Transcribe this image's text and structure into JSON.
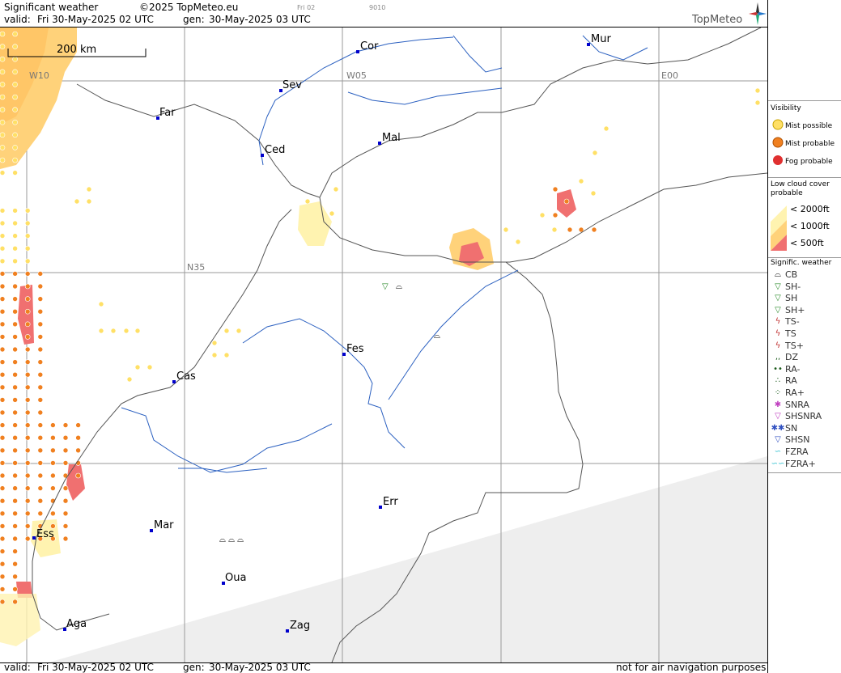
{
  "header": {
    "title": "Significant weather",
    "copyright": "©2025 TopMeteo.eu",
    "tiny_day": "Fri 02",
    "tiny_code": "9010",
    "valid_label": "valid:",
    "valid_value": "Fri  30-May-2025  02 UTC",
    "gen_label": "gen:",
    "gen_value": "30-May-2025 03 UTC",
    "logo": "TopMeteo"
  },
  "footer": {
    "valid_label": "valid:",
    "valid_value": "Fri  30-May-2025  02 UTC",
    "gen_label": "gen:",
    "gen_value": "30-May-2025 03 UTC",
    "disclaimer": "not for air navigation purposes"
  },
  "map": {
    "scale_label": "200 km",
    "grid_labels": [
      "W10",
      "W05",
      "E00",
      "N35"
    ],
    "cities": [
      "Cor",
      "Mur",
      "Sev",
      "Far",
      "Mal",
      "Ced",
      "Fes",
      "Cas",
      "Err",
      "Mar",
      "Ess",
      "Oua",
      "Aga",
      "Zag"
    ],
    "colors": {
      "mist_possible": "#ffe066",
      "mist_probable": "#f08020",
      "fog_probable": "#e03030",
      "cloud_2000": "#fff3b0",
      "cloud_1000": "#ffd27a",
      "cloud_500": "#f07070",
      "grid": "#999999",
      "city": "#0000cc",
      "outside": "#eeeeee"
    }
  },
  "legend": {
    "visibility_title": "Visibility",
    "mist_possible": "Mist possible",
    "mist_probable": "Mist probable",
    "fog_probable": "Fog probable",
    "lowcloud_title": "Low cloud cover probable",
    "lc_2000": "< 2000ft",
    "lc_1000": "< 1000ft",
    "lc_500": "<   500ft",
    "sigwx_title": "Signific. weather",
    "sigwx": [
      {
        "code": "CB",
        "icon": "cb-icon"
      },
      {
        "code": "SH-",
        "icon": "shower-light-icon"
      },
      {
        "code": "SH",
        "icon": "shower-icon"
      },
      {
        "code": "SH+",
        "icon": "shower-heavy-icon"
      },
      {
        "code": "TS-",
        "icon": "thunderstorm-light-icon"
      },
      {
        "code": "TS",
        "icon": "thunderstorm-icon"
      },
      {
        "code": "TS+",
        "icon": "thunderstorm-heavy-icon"
      },
      {
        "code": "DZ",
        "icon": "drizzle-icon"
      },
      {
        "code": "RA-",
        "icon": "rain-light-icon"
      },
      {
        "code": "RA",
        "icon": "rain-icon"
      },
      {
        "code": "RA+",
        "icon": "rain-heavy-icon"
      },
      {
        "code": "SNRA",
        "icon": "snow-rain-icon"
      },
      {
        "code": "SHSNRA",
        "icon": "snow-rain-shower-icon"
      },
      {
        "code": "SN",
        "icon": "snow-icon"
      },
      {
        "code": "SHSN",
        "icon": "snow-shower-icon"
      },
      {
        "code": "FZRA",
        "icon": "freezing-rain-icon"
      },
      {
        "code": "FZRA+",
        "icon": "freezing-rain-heavy-icon"
      }
    ]
  }
}
